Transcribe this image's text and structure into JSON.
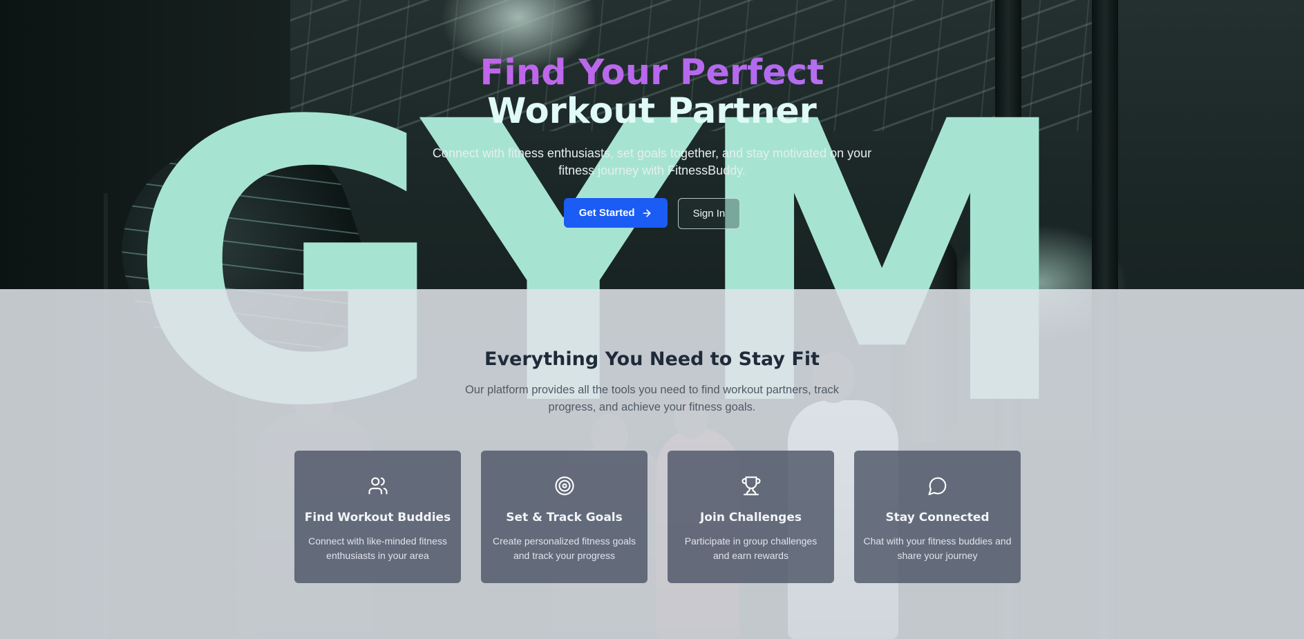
{
  "hero": {
    "title_line1": "Find Your Perfect",
    "title_line2": "Workout Partner",
    "subtitle": "Connect with fitness enthusiasts, set goals together, and stay motivated on your fitness journey with FitnessBuddy.",
    "primary_button": "Get Started",
    "secondary_button": "Sign In",
    "background_word": "GYM"
  },
  "features": {
    "title": "Everything You Need to Stay Fit",
    "subtitle": "Our platform provides all the tools you need to find workout partners, track progress, and achieve your fitness goals.",
    "cards": [
      {
        "icon": "users-icon",
        "title": "Find Workout Buddies",
        "description": "Connect with like-minded fitness enthusiasts in your area"
      },
      {
        "icon": "target-icon",
        "title": "Set & Track Goals",
        "description": "Create personalized fitness goals and track your progress"
      },
      {
        "icon": "trophy-icon",
        "title": "Join Challenges",
        "description": "Participate in group challenges and earn rewards"
      },
      {
        "icon": "message-circle-icon",
        "title": "Stay Connected",
        "description": "Chat with your fitness buddies and share your journey"
      }
    ]
  },
  "colors": {
    "primary": "#1b5cf5",
    "accent_gradient_start": "#d35fe0",
    "accent_gradient_end": "#e6a8f5",
    "watermark": "#a6e4d1",
    "card_bg": "#485062"
  }
}
